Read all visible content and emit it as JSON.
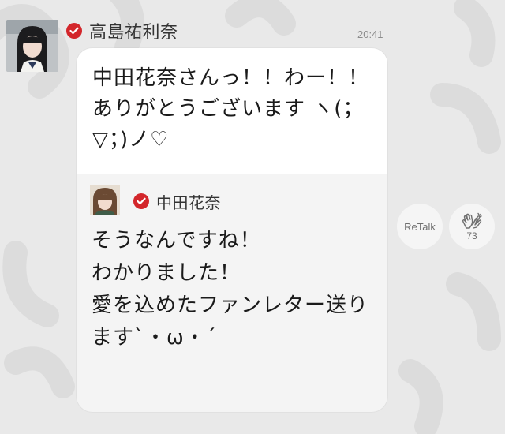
{
  "message": {
    "sender_name": "高島祐利奈",
    "sender_avatar": "girl-portrait-avatar",
    "verified_icon": "red-check-badge",
    "time": "20:41",
    "text": "中田花奈さんっ！！わー！！ありがとうございます ヽ(；▽；)ノ♡"
  },
  "quoted": {
    "author_name": "中田花奈",
    "author_avatar": "girl-small-avatar",
    "text": "そうなんですね！\nわかりました！\n愛を込めたファンレター送りますˋ・ω・ˊ"
  },
  "actions": {
    "retalk_label": "ReTalk",
    "clap_icon": "clapping-hands-icon",
    "clap_count": "73"
  },
  "colors": {
    "background": "#e9e9e9",
    "bubble": "#ffffff",
    "quote_area": "#f4f4f4",
    "verified": "#d3262b"
  }
}
